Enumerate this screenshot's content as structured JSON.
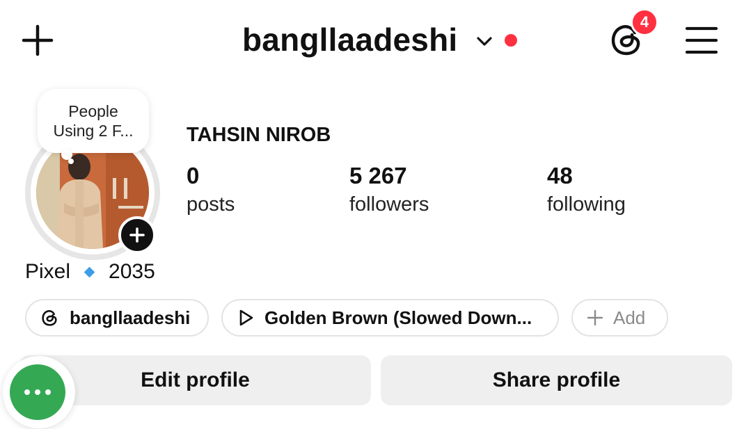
{
  "header": {
    "username": "bangllaadeshi",
    "notification_count": "4",
    "icons": [
      "plus-icon",
      "chevron-down-icon",
      "threads-icon",
      "hamburger-menu-icon"
    ],
    "accent_red": "#ff3040"
  },
  "profile": {
    "note_line1": "People",
    "note_line2": "Using 2 F...",
    "full_name": "TAHSIN NIROB",
    "stats": [
      {
        "value": "0",
        "label": "posts"
      },
      {
        "value": "5 267",
        "label": "followers"
      },
      {
        "value": "48",
        "label": "following"
      }
    ],
    "bio_left": "Pixel",
    "bio_right": "2035",
    "diamond_color": "#3b9de8"
  },
  "chips": {
    "threads_label": "bangllaadeshi",
    "music_label": "Golden Brown (Slowed Down...",
    "add_label": "Add"
  },
  "buttons": {
    "edit": "Edit profile",
    "share": "Share profile"
  },
  "floating": {
    "color": "#34a853",
    "icon": "more-dots-icon"
  }
}
